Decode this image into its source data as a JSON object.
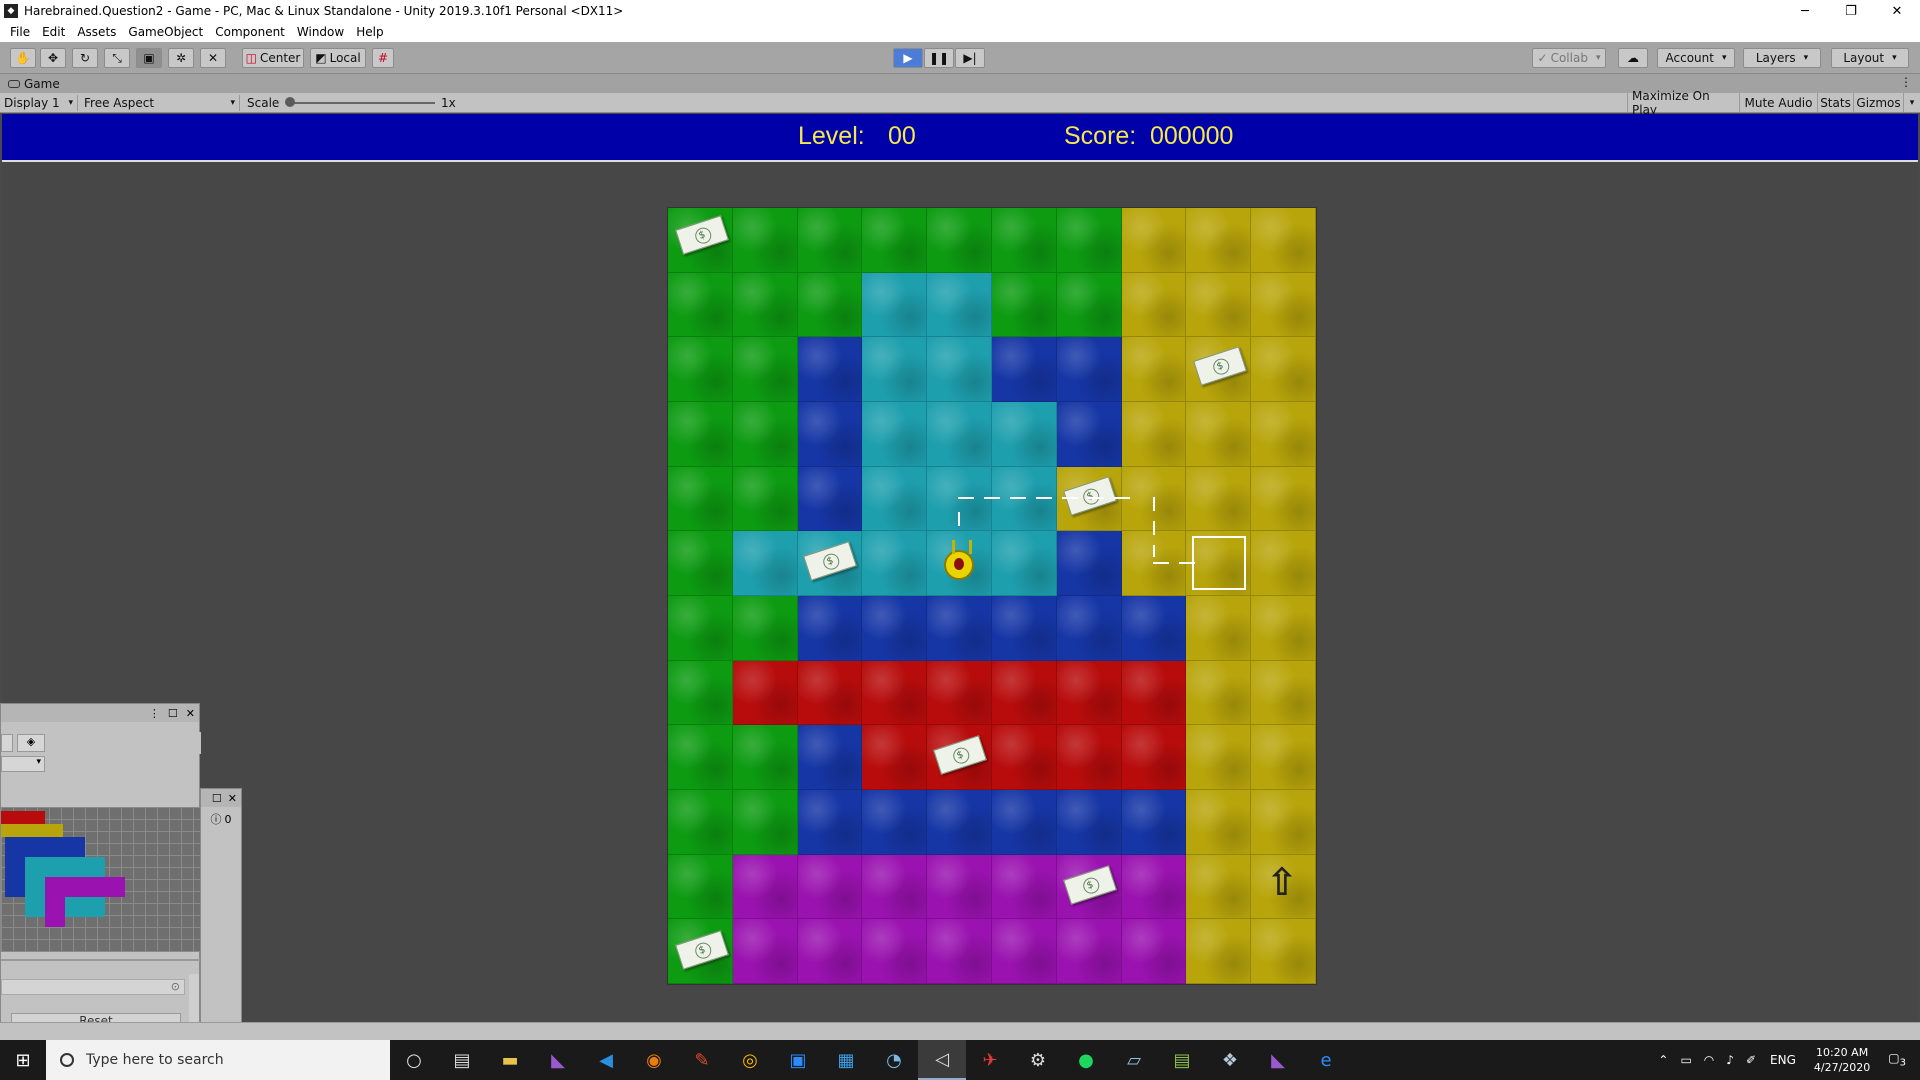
{
  "window": {
    "title": "Harebrained.Question2 - Game - PC, Mac & Linux Standalone - Unity 2019.3.10f1 Personal <DX11>",
    "minimize": "─",
    "maximize": "❐",
    "close": "✕"
  },
  "menu": [
    "File",
    "Edit",
    "Assets",
    "GameObject",
    "Component",
    "Window",
    "Help"
  ],
  "toolbar": {
    "tools": [
      "hand-tool",
      "move-tool",
      "rotate-tool",
      "scale-tool",
      "rect-tool",
      "transform-tool",
      "custom-tool"
    ],
    "center_label": "Center",
    "local_label": "Local",
    "collab_label": "Collab",
    "account_label": "Account",
    "layers_label": "Layers",
    "layout_label": "Layout"
  },
  "game_tab": {
    "label": "Game",
    "display": "Display 1",
    "aspect": "Free Aspect",
    "scale_label": "Scale",
    "scale_value": "1x",
    "scale_fraction": 0.0,
    "maximize_on_play": "Maximize On Play",
    "mute_audio": "Mute Audio",
    "stats": "Stats",
    "gizmos": "Gizmos"
  },
  "hud": {
    "level_label": "Level:",
    "level_value": "00",
    "score_label": "Score:",
    "score_value": "000000"
  },
  "board": {
    "columns": 10,
    "rows": 12,
    "tiles": [
      "g",
      "g",
      "g",
      "g",
      "g",
      "g",
      "g",
      "y",
      "y",
      "y",
      "g",
      "g",
      "g",
      "c",
      "c",
      "g",
      "g",
      "y",
      "y",
      "y",
      "g",
      "g",
      "b",
      "c",
      "c",
      "b",
      "b",
      "y",
      "y",
      "y",
      "g",
      "g",
      "b",
      "c",
      "c",
      "c",
      "b",
      "y",
      "y",
      "y",
      "g",
      "g",
      "b",
      "c",
      "c",
      "c",
      "y",
      "y",
      "y",
      "y",
      "g",
      "c",
      "c",
      "c",
      "c",
      "c",
      "b",
      "y",
      "y",
      "y",
      "g",
      "g",
      "b",
      "b",
      "b",
      "b",
      "b",
      "b",
      "y",
      "y",
      "g",
      "r",
      "r",
      "r",
      "r",
      "r",
      "r",
      "r",
      "y",
      "y",
      "g",
      "g",
      "b",
      "r",
      "r",
      "r",
      "r",
      "r",
      "y",
      "y",
      "g",
      "g",
      "b",
      "b",
      "b",
      "b",
      "b",
      "b",
      "y",
      "y",
      "g",
      "m",
      "m",
      "m",
      "m",
      "m",
      "m",
      "m",
      "y",
      "y",
      "g",
      "m",
      "m",
      "m",
      "m",
      "m",
      "m",
      "m",
      "y",
      "y"
    ],
    "money_symbol": "$"
  },
  "palette": {
    "reset_label": "Reset",
    "console_count": "0"
  },
  "taskbar": {
    "search_placeholder": "Type here to search",
    "language": "ENG",
    "time": "10:20 AM",
    "date": "4/27/2020",
    "notifications": "3"
  }
}
